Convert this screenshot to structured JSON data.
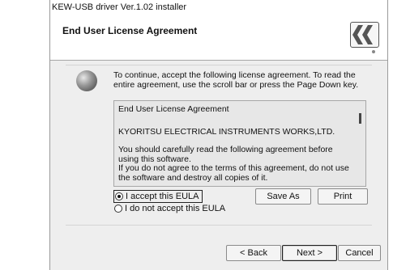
{
  "window": {
    "title": "KEW-USB driver Ver.1.02 installer"
  },
  "header": {
    "title": "End User License Agreement"
  },
  "instructions": "To continue, accept the following license agreement. To read the entire agreement, use the scroll bar or press the Page Down key.",
  "license": {
    "lines": [
      "End User License Agreement",
      "KYORITSU ELECTRICAL INSTRUMENTS WORKS,LTD.",
      "You should carefully read the following agreement before using this software.",
      "If you do not agree to the terms of this agreement, do not use the software and destroy all copies of it."
    ]
  },
  "options": {
    "accept_label": "I accept this EULA",
    "decline_label": "I do not accept this EULA",
    "selected": "accept"
  },
  "buttons": {
    "save_as": "Save As",
    "print": "Print",
    "back": "< Back",
    "next": "Next >",
    "cancel": "Cancel"
  }
}
